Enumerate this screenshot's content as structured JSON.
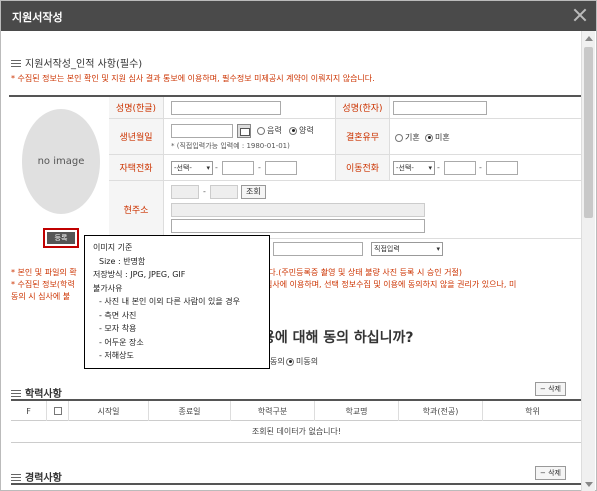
{
  "window": {
    "title": "지원서작성"
  },
  "section": {
    "title": "지원서작성_인적 사항(필수)",
    "notice": "* 수집된 정보는 본인 확인 및 지원 심사 결과 통보에 이용하며, 필수정보 미제공시 계약이 이뤄지지 않습니다."
  },
  "photo": {
    "placeholder": "no image",
    "register_label": "등록"
  },
  "form": {
    "name_kr_label": "성명(한글)",
    "name_cn_label": "성명(한자)",
    "birth_label": "생년월일",
    "lunar_label": "음력",
    "solar_label": "양력",
    "birth_hint": "* (직접입력가능 입력예 : 1980-01-01)",
    "marital_label": "결혼유무",
    "married_label": "기혼",
    "single_label": "미혼",
    "home_phone_label": "자택전화",
    "mobile_label": "이동전화",
    "select_placeholder": "-선택-",
    "address_label": "현주소",
    "search_label": "조회",
    "email_domain_select": "직접입력"
  },
  "tooltip": {
    "lines": [
      "이미지 기준",
      "Size : 반명함",
      "저장방식 : JPG, JPEG, GIF",
      "불가사유",
      "- 사진 내 본인 이외 다른 사람이 있을 경우",
      "- 측면 사진",
      "- 모자 착용",
      "- 어두운 장소",
      "- 저해상도"
    ]
  },
  "notices2": {
    "line1a": "* 본인 및 파일의 확",
    "line1b": "니다.(주민등록증 촬영 및 상태 불량 사진 등록 시 승인 거절)",
    "line2a": "* 수집된 정보(학력",
    "line2b": "심사에 이용하며, 선택 정보수집 및 이용에 동의하지 않을 권리가 있으나, 미",
    "line3a": "동의 시 심사에 불",
    "consent_question": "용에 대해 동의 하십니까?",
    "agree_label": "동의",
    "disagree_label": "미동의"
  },
  "education": {
    "title": "학력사항",
    "delete_label": "삭제",
    "columns": [
      "F",
      "",
      "시작일",
      "종료일",
      "학력구분",
      "학교명",
      "학과(전공)",
      "학위"
    ],
    "empty_message": "조회된 데이터가 없습니다!"
  },
  "career": {
    "title": "경력사항",
    "delete_label": "삭제"
  }
}
